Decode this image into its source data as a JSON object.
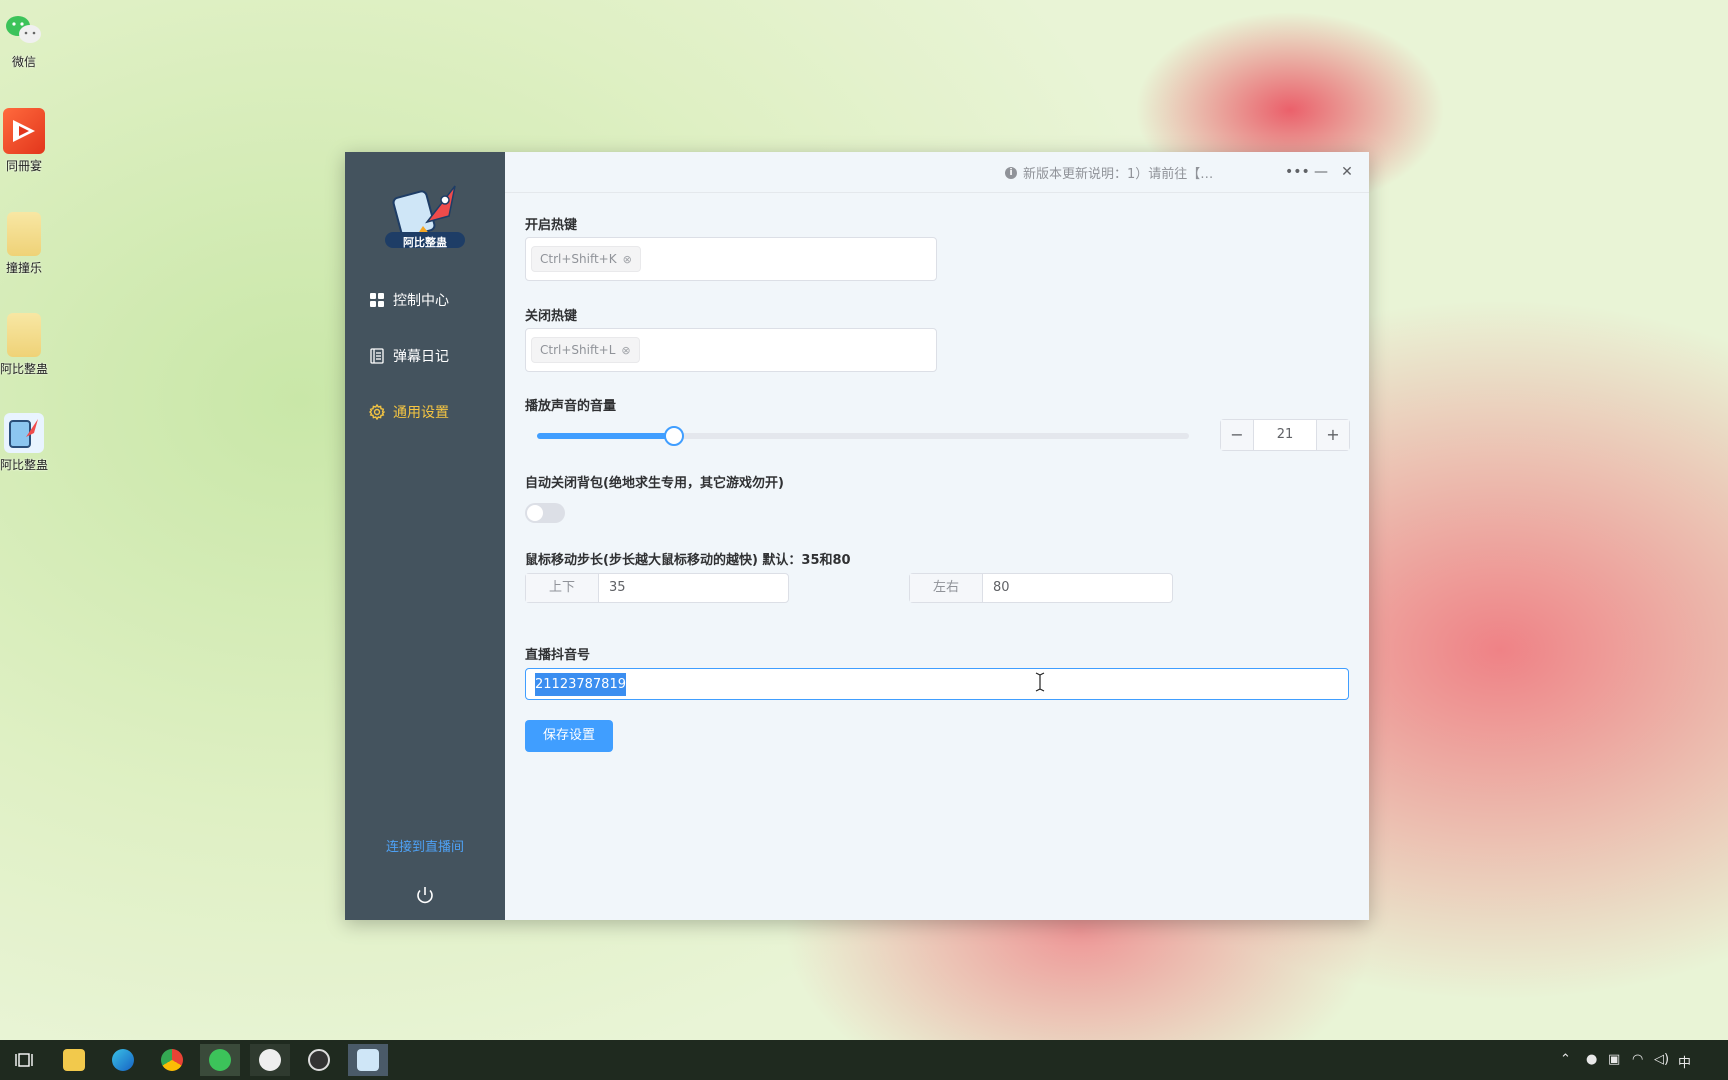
{
  "desktop": {
    "icons": [
      {
        "label": "微信",
        "icon": "wechat-icon"
      },
      {
        "label": "同冊宴",
        "icon": "app-shortcut-icon"
      },
      {
        "label": "撞撞乐",
        "icon": "folder-icon"
      },
      {
        "label": "阿比整蛊",
        "icon": "folder-icon"
      },
      {
        "label": "阿比整蛊",
        "icon": "rocket-app-icon"
      }
    ]
  },
  "app": {
    "logo_text": "阿比整蛊",
    "nav": [
      {
        "label": "控制中心",
        "icon": "grid-icon",
        "active": false
      },
      {
        "label": "弹幕日记",
        "icon": "notebook-icon",
        "active": false
      },
      {
        "label": "通用设置",
        "icon": "gear-icon",
        "active": true
      }
    ],
    "connect_link": "连接到直播间",
    "titlebar": {
      "notice": "新版本更新说明：1）请前往【…"
    },
    "settings": {
      "open_hotkey_label": "开启热键",
      "open_hotkey_value": "Ctrl+Shift+K",
      "close_hotkey_label": "关闭热键",
      "close_hotkey_value": "Ctrl+Shift+L",
      "volume_label": "播放声音的音量",
      "volume_value": "21",
      "volume_percent": 21,
      "auto_close_label": "自动关闭背包(绝地求生专用，其它游戏勿开)",
      "auto_close_on": false,
      "mouse_step_label": "鼠标移动步长(步长越大鼠标移动的越快) 默认：35和80",
      "updown_label": "上下",
      "updown_value": "35",
      "leftright_label": "左右",
      "leftright_value": "80",
      "douyin_label": "直播抖音号",
      "douyin_value": "21123787819",
      "save_button": "保存设置"
    }
  },
  "taskbar": {
    "ime": "中"
  },
  "colors": {
    "sidebar_bg": "#44535e",
    "accent": "#409eff",
    "active_nav": "#f5c542"
  }
}
